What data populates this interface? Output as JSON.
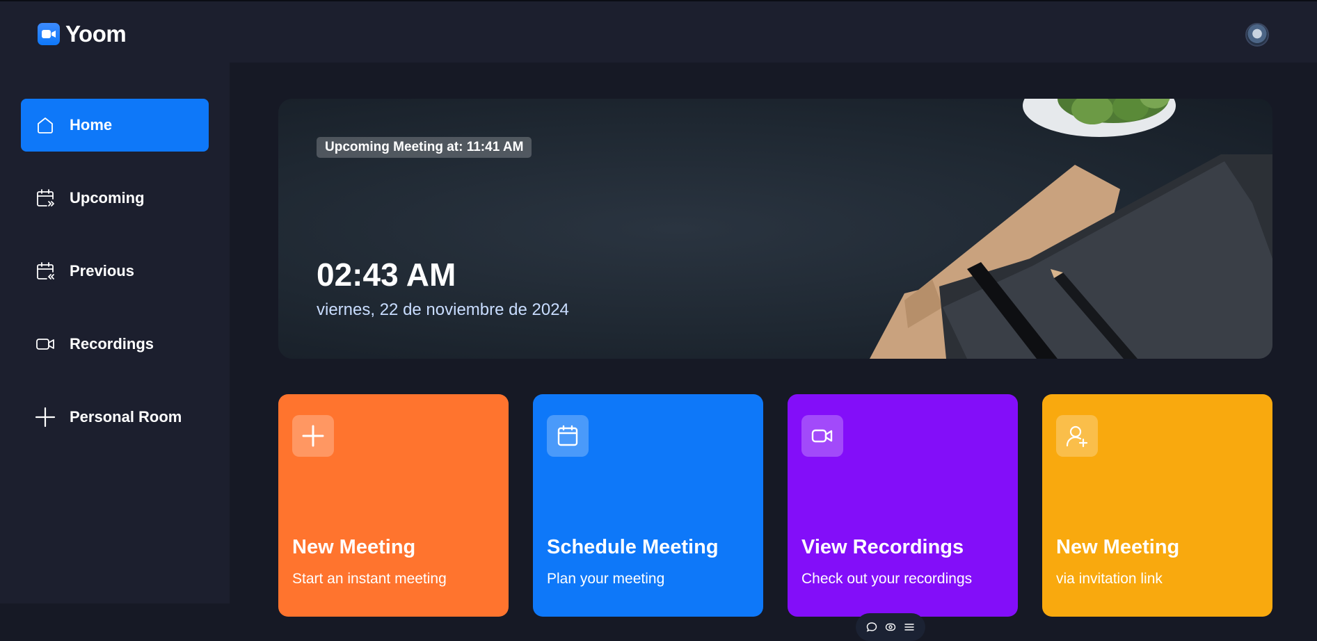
{
  "app": {
    "name": "Yoom",
    "brand_color": "#0e78f9"
  },
  "header": {
    "logo_icon": "video-camera-icon",
    "avatar": "user-avatar"
  },
  "sidebar": {
    "items": [
      {
        "label": "Home",
        "icon": "home-icon",
        "active": true
      },
      {
        "label": "Upcoming",
        "icon": "calendar-forward-icon",
        "active": false
      },
      {
        "label": "Previous",
        "icon": "calendar-back-icon",
        "active": false
      },
      {
        "label": "Recordings",
        "icon": "video-icon",
        "active": false
      },
      {
        "label": "Personal Room",
        "icon": "plus-icon",
        "active": false
      }
    ]
  },
  "hero": {
    "upcoming_badge": "Upcoming Meeting at: 11:41 AM",
    "time": "02:43 AM",
    "date": "viernes, 22 de noviembre de 2024"
  },
  "cards": [
    {
      "title": "New Meeting",
      "description": "Start an instant meeting",
      "icon": "plus-icon",
      "color": "#ff742e"
    },
    {
      "title": "Schedule Meeting",
      "description": "Plan your meeting",
      "icon": "calendar-icon",
      "color": "#0e78f9"
    },
    {
      "title": "View Recordings",
      "description": "Check out your recordings",
      "icon": "video-icon",
      "color": "#830ef9"
    },
    {
      "title": "New Meeting",
      "description": "via invitation link",
      "icon": "add-user-icon",
      "color": "#f9a90e"
    }
  ],
  "floating_toolbar": {
    "buttons": [
      "chat-icon",
      "eye-icon",
      "menu-icon"
    ]
  }
}
